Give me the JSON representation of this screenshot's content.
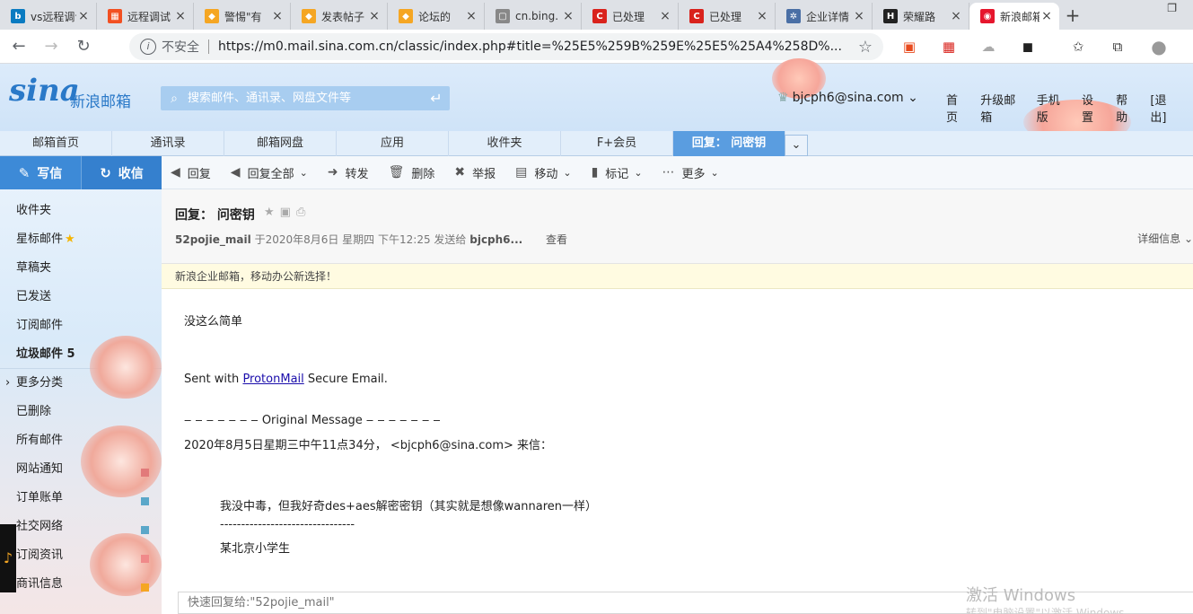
{
  "browser": {
    "tabs": [
      {
        "title": "vs远程调试",
        "fav_color": "#0a7bc1",
        "fav_glyph": "b"
      },
      {
        "title": "远程调试",
        "fav_color": "#f25022",
        "fav_glyph": "▦"
      },
      {
        "title": "警惕\"有",
        "fav_color": "#f5a623",
        "fav_glyph": "◆"
      },
      {
        "title": "发表帖子",
        "fav_color": "#f5a623",
        "fav_glyph": "◆"
      },
      {
        "title": "论坛的",
        "fav_color": "#f5a623",
        "fav_glyph": "◆"
      },
      {
        "title": "cn.bing.",
        "fav_color": "#888888",
        "fav_glyph": "▢"
      },
      {
        "title": "已处理",
        "fav_color": "#d9221c",
        "fav_glyph": "C"
      },
      {
        "title": "已处理",
        "fav_color": "#d9221c",
        "fav_glyph": "C"
      },
      {
        "title": "企业详情",
        "fav_color": "#4a6fa5",
        "fav_glyph": "✲"
      },
      {
        "title": "荣耀路",
        "fav_color": "#222222",
        "fav_glyph": "H"
      },
      {
        "title": "新浪邮箱",
        "fav_color": "#e6162d",
        "fav_glyph": "◉",
        "active": true
      }
    ],
    "new_tab": "+",
    "insecure_label": "不安全",
    "url": "https://m0.mail.sina.com.cn/classic/index.php#title=%25E5%259B%259E%25E5%25A4%258D%..."
  },
  "header": {
    "logo_text": "sina",
    "logo_cn": "新浪邮箱",
    "search_placeholder": "搜索邮件、通讯录、网盘文件等",
    "user_email": "bjcph6@sina.com",
    "links": [
      "首页",
      "升级邮箱",
      "手机版",
      "设置",
      "帮助",
      "[退出]"
    ]
  },
  "main_tabs": [
    "邮箱首页",
    "通讯录",
    "邮箱网盘",
    "应用",
    "收件夹",
    "F+会员",
    "回复： 问密钥"
  ],
  "sidebar": {
    "compose": "写信",
    "receive": "收信",
    "folders": [
      {
        "label": "收件夹"
      },
      {
        "label": "星标邮件"
      },
      {
        "label": "草稿夹"
      },
      {
        "label": "已发送"
      },
      {
        "label": "订阅邮件"
      },
      {
        "label": "垃圾邮件 5",
        "bold": true
      },
      {
        "label": "更多分类",
        "caret": true
      },
      {
        "label": "已删除"
      },
      {
        "label": "所有邮件"
      },
      {
        "label": "网站通知"
      },
      {
        "label": "订单账单"
      },
      {
        "label": "社交网络"
      },
      {
        "label": "订阅资讯"
      },
      {
        "label": "商讯信息"
      }
    ]
  },
  "toolbar": {
    "reply": "回复",
    "reply_all": "回复全部",
    "forward": "转发",
    "delete": "删除",
    "report": "举报",
    "move": "移动",
    "mark": "标记",
    "more": "更多"
  },
  "message": {
    "subject": "回复： 问密钥",
    "sender": "52pojie_mail",
    "date_text": "于2020年8月6日 星期四 下午12:25 发送给",
    "recipient": "bjcph6...",
    "view": "查看",
    "details": "详细信息",
    "notice": "新浪企业邮箱，移动办公新选择！",
    "body": {
      "line1": "没这么简单",
      "sent_prefix": "Sent with ",
      "sent_link": "ProtonMail",
      "sent_suffix": " Secure Email.",
      "original": "‒ ‒ ‒ ‒ ‒ ‒ ‒ Original Message ‒ ‒ ‒ ‒ ‒ ‒ ‒",
      "original_header": "2020年8月5日星期三中午11点34分， <bjcph6@sina.com> 来信：",
      "quoted1": "我没中毒，但我好奇des+aes解密密钥（其实就是想像wannaren一样）",
      "quoted_sep": "--------------------------------",
      "quoted2": "某北京小学生"
    },
    "quick_reply_placeholder": "快速回复给:\"52pojie_mail\""
  },
  "watermark": {
    "line1": "激活 Windows",
    "line2": "转到\"电脑设置\"以激活 Windows"
  }
}
